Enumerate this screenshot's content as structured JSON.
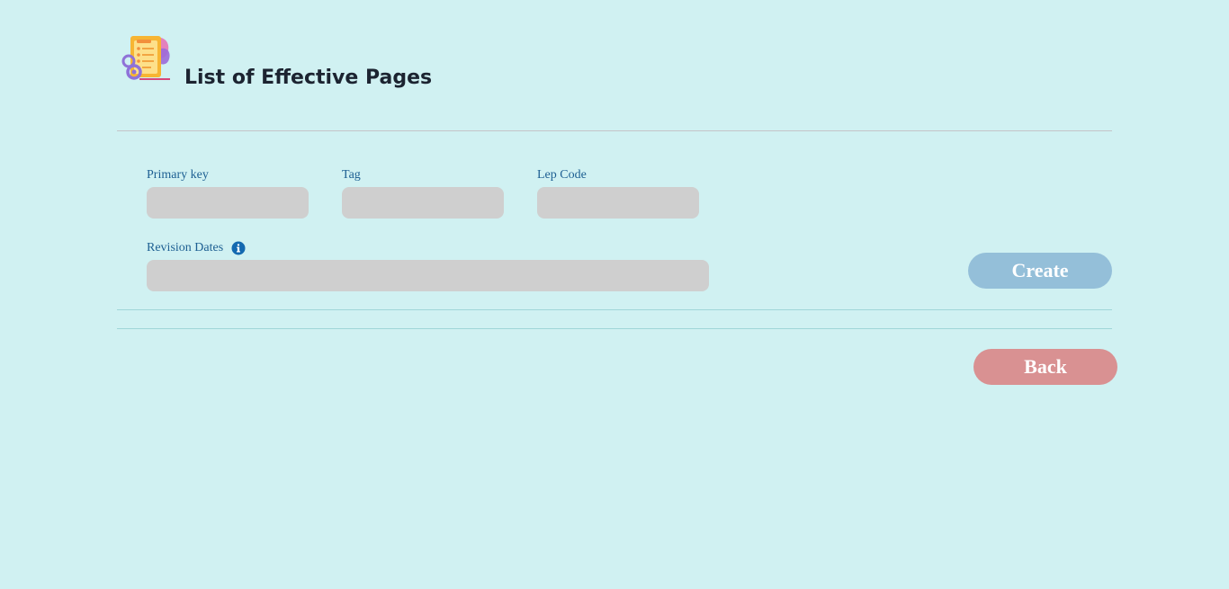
{
  "header": {
    "title": "List of Effective Pages",
    "logo_icon": "document-checklist-icon"
  },
  "form": {
    "primary_key": {
      "label": "Primary key",
      "value": "",
      "placeholder": ""
    },
    "tag": {
      "label": "Tag",
      "value": "",
      "placeholder": ""
    },
    "lep_code": {
      "label": "Lep Code",
      "value": "",
      "placeholder": ""
    },
    "revision_dates": {
      "label": "Revision Dates",
      "value": "",
      "placeholder": "",
      "info_icon": "info-icon"
    }
  },
  "actions": {
    "create_label": "Create",
    "back_label": "Back"
  },
  "colors": {
    "background": "#d0f1f2",
    "label": "#1d5f92",
    "input": "#cfcfcf",
    "create_button": "#94bfd9",
    "back_button": "#d99192",
    "title": "#1c2431"
  }
}
